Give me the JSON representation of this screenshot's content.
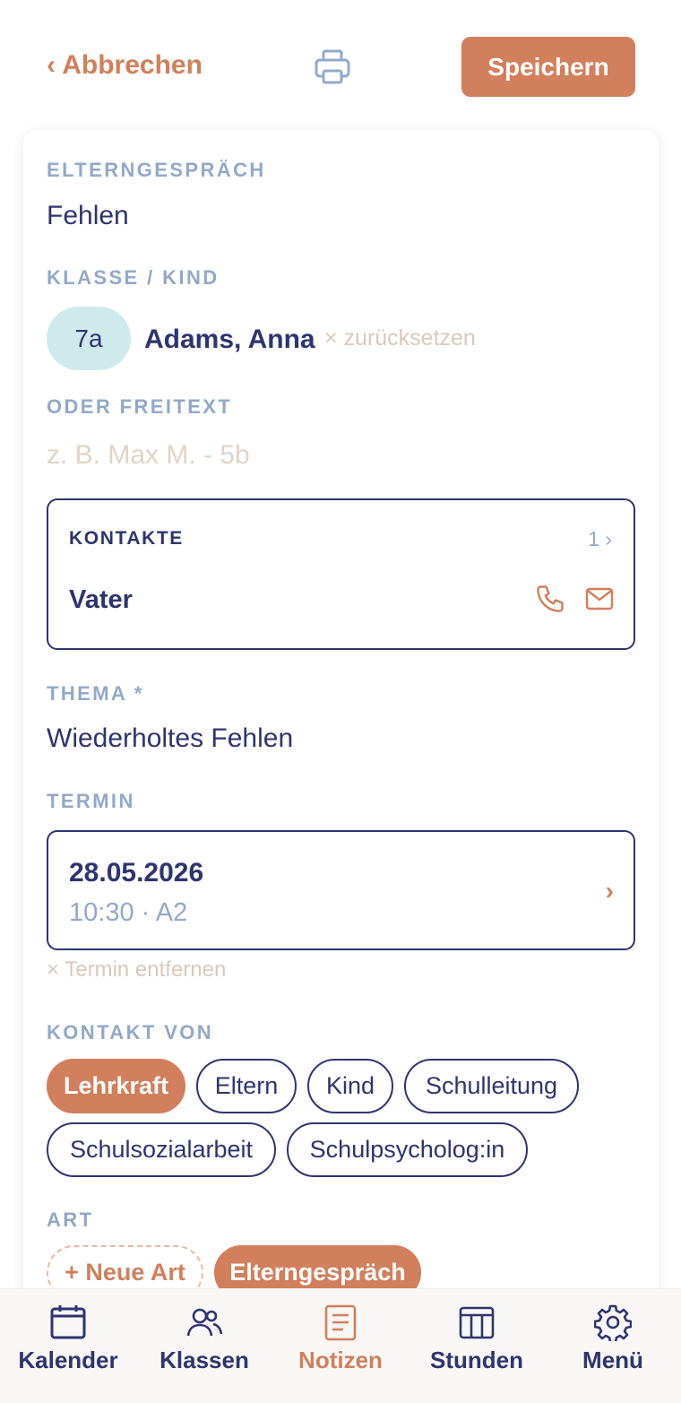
{
  "header": {
    "cancel_label": "‹ Abbrechen",
    "print_icon": "printer-icon",
    "save_label": "Speichern"
  },
  "form": {
    "type_label": "ELTERNGESPRÄCH",
    "type_value": "Fehlen",
    "class_child_label": "KLASSE / KIND",
    "class_badge": "7a",
    "child_name": "Adams, Anna",
    "reset_label": "× zurücksetzen",
    "freetext_label": "ODER FREITEXT",
    "freetext_placeholder": "z. B. Max M. - 5b",
    "contacts": {
      "title": "KONTAKTE",
      "count": "1 ›",
      "name": "Vater"
    },
    "topic_label": "THEMA *",
    "topic_value": "Wiederholtes Fehlen",
    "appointment_label": "TERMIN",
    "appointment": {
      "date": "28.05.2026",
      "details": "10:30 · A2",
      "chevron": "›",
      "remove_label": "× Termin entfernen"
    },
    "contact_from_label": "KONTAKT VON",
    "contact_from_options": [
      "Lehrkraft",
      "Eltern",
      "Kind",
      "Schulleitung",
      "Schulsozialarbeit",
      "Schulpsycholog:in"
    ],
    "contact_from_selected": "Lehrkraft",
    "kind_label": "ART",
    "new_kind_label": "+ Neue Art",
    "kind_selected": "Elterngespräch"
  },
  "nav": {
    "items": [
      {
        "label": "Kalender",
        "icon": "calendar-icon"
      },
      {
        "label": "Klassen",
        "icon": "people-icon"
      },
      {
        "label": "Notizen",
        "icon": "notes-icon"
      },
      {
        "label": "Stunden",
        "icon": "timetable-icon"
      },
      {
        "label": "Menü",
        "icon": "gear-icon"
      }
    ],
    "active": "Notizen"
  },
  "colors": {
    "accent": "#d17f5c",
    "navy": "#2e3470",
    "label_blue": "#93a8c9",
    "class_badge_bg": "#cfeaea",
    "muted_beige": "#d9c8bc"
  }
}
